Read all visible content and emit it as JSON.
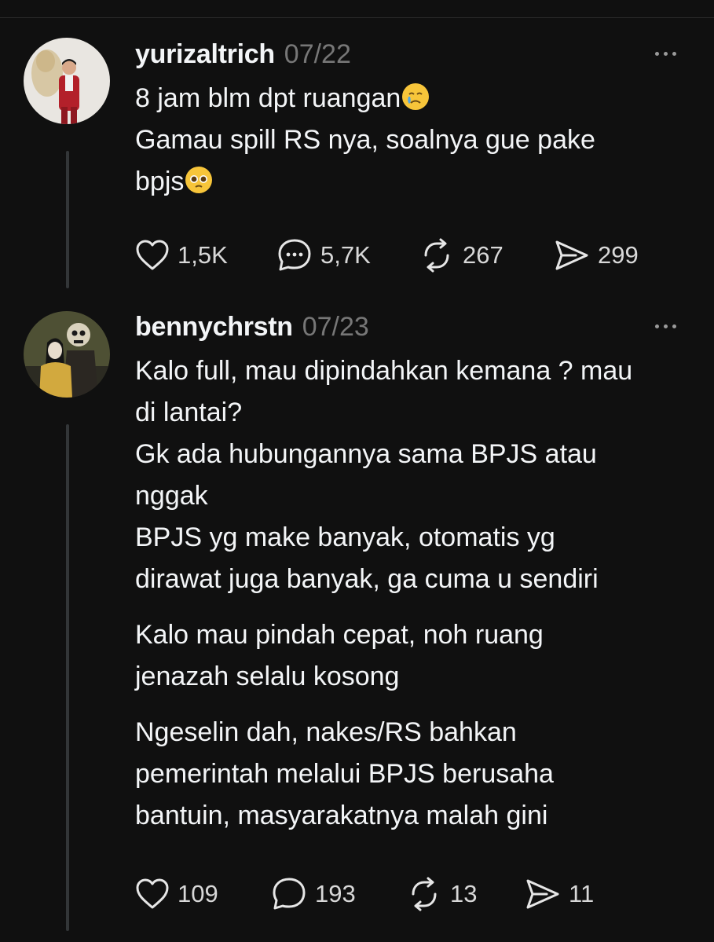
{
  "posts": [
    {
      "username": "yurizaltrich",
      "date": "07/22",
      "paragraphs": [
        [
          "8 jam blm dpt ruangan",
          "Gamau spill RS nya, soalnya gue pake",
          "bpjs"
        ]
      ],
      "emojis": [
        "crying-face-emoji",
        "pleading-face-emoji"
      ],
      "likes": "1,5K",
      "replies": "5,7K",
      "reposts": "267",
      "shares": "299"
    },
    {
      "username": "bennychrstn",
      "date": "07/23",
      "paragraphs": [
        [
          "Kalo full, mau dipindahkan kemana ? mau",
          "di lantai?",
          "Gk ada hubungannya sama BPJS atau",
          "nggak",
          "BPJS yg make banyak, otomatis yg",
          "dirawat juga banyak, ga cuma u sendiri"
        ],
        [
          "Kalo mau pindah cepat, noh ruang",
          "jenazah selalu kosong"
        ],
        [
          "Ngeselin dah, nakes/RS bahkan",
          "pemerintah melalui BPJS berusaha",
          "bantuin, masyarakatnya malah gini"
        ]
      ],
      "likes": "109",
      "replies": "193",
      "reposts": "13",
      "shares": "11"
    }
  ],
  "colors": {
    "background": "#101010",
    "text": "#f3f5f7",
    "muted": "#777777",
    "thread_line": "#333638"
  }
}
